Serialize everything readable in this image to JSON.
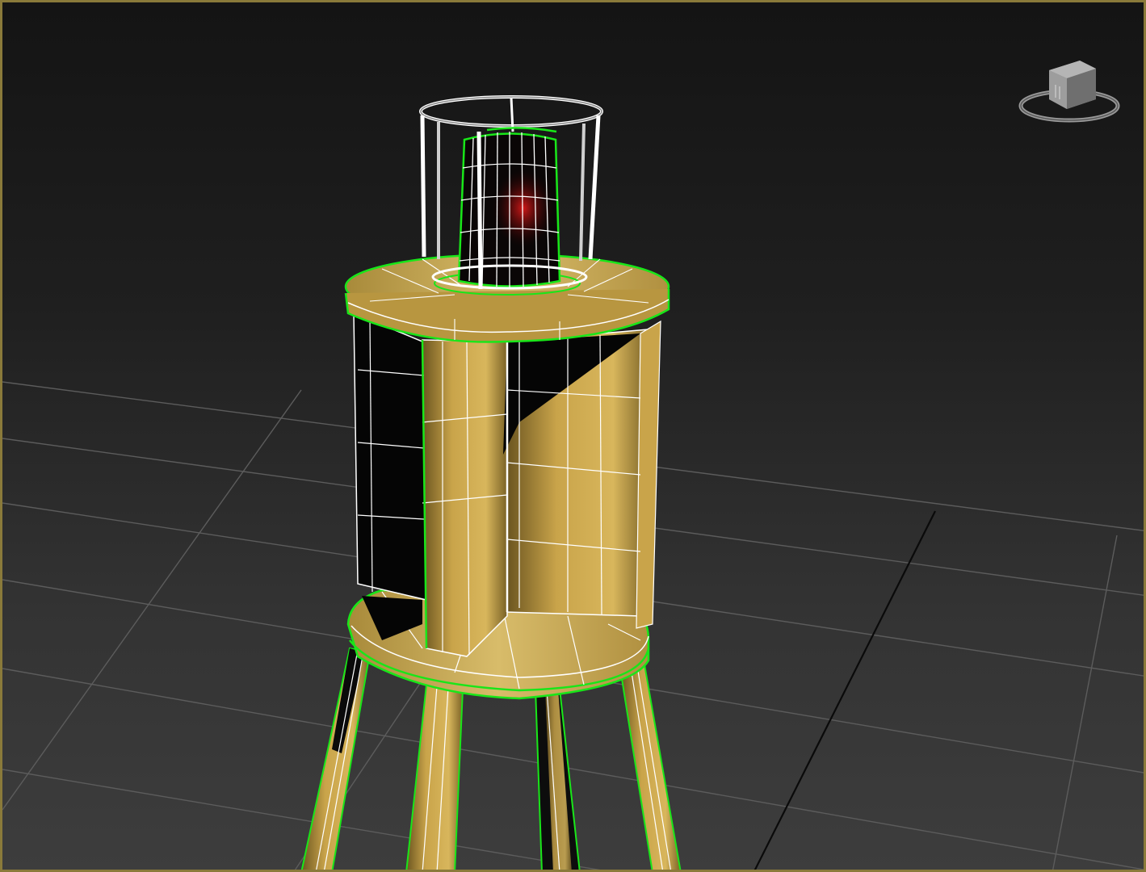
{
  "viewport": {
    "label": "",
    "colors": {
      "background_top": "#141414",
      "background_bottom": "#3d3d3d",
      "active_border": "#8a7a3a",
      "grid": "#5a5a5a",
      "grid_axis": "#0a0a0a",
      "wireframe": "#ffffff",
      "selection_edge": "#19e619",
      "wood": "#c9a44a",
      "shadow": "#050505",
      "lamp_glow": "#b01010"
    }
  },
  "scene": {
    "object": "lamp-stand",
    "shading": "wood-with-wireframe",
    "selected": true
  },
  "viewcube": {
    "icon": "viewcube-icon",
    "label": ""
  }
}
